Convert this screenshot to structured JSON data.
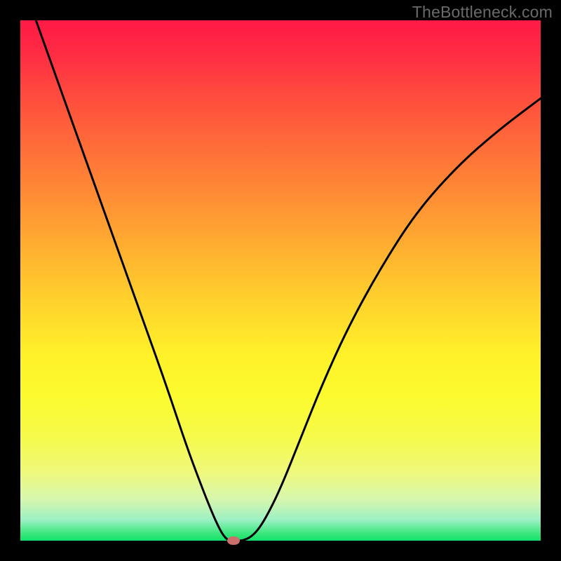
{
  "watermark": "TheBottleneck.com",
  "chart_data": {
    "type": "line",
    "title": "",
    "xlabel": "",
    "ylabel": "",
    "xlim": [
      0,
      1
    ],
    "ylim": [
      0,
      1
    ],
    "grid": false,
    "legend": false,
    "series": [
      {
        "name": "curve",
        "color": "#000000",
        "x": [
          0.03,
          0.08,
          0.13,
          0.18,
          0.23,
          0.28,
          0.32,
          0.35,
          0.37,
          0.385,
          0.395,
          0.403,
          0.41,
          0.43,
          0.45,
          0.47,
          0.5,
          0.54,
          0.58,
          0.63,
          0.69,
          0.76,
          0.84,
          0.92,
          1.0
        ],
        "y": [
          1.0,
          0.86,
          0.72,
          0.58,
          0.44,
          0.3,
          0.18,
          0.1,
          0.05,
          0.018,
          0.004,
          0.0,
          0.0,
          0.0,
          0.012,
          0.04,
          0.1,
          0.2,
          0.3,
          0.41,
          0.52,
          0.63,
          0.72,
          0.79,
          0.85
        ]
      }
    ],
    "marker": {
      "x": 0.41,
      "y": 0.0,
      "color": "#cc6f6a"
    },
    "gradient_stops": [
      {
        "pos": 0.0,
        "color": "#ff1a46"
      },
      {
        "pos": 0.34,
        "color": "#ff8e35"
      },
      {
        "pos": 0.64,
        "color": "#fff029"
      },
      {
        "pos": 0.92,
        "color": "#d7f7ae"
      },
      {
        "pos": 1.0,
        "color": "#11e26a"
      }
    ]
  }
}
